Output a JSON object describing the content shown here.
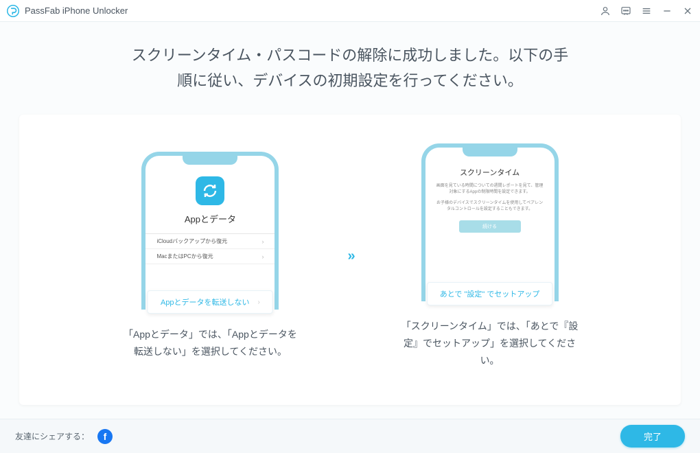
{
  "app": {
    "title": "PassFab iPhone Unlocker"
  },
  "header": {
    "line1": "スクリーンタイム・パスコードの解除に成功しました。以下の手",
    "line2": "順に従い、デバイスの初期設定を行ってください。"
  },
  "step1": {
    "phone_title": "Appとデータ",
    "row1": "iCloudバックアップから復元",
    "row2": "MacまたはPCから復元",
    "highlight": "Appとデータを転送しない",
    "desc": "「Appとデータ」では、「Appとデータを転送しない」を選択してください。"
  },
  "arrow": "»",
  "step2": {
    "phone_title": "スクリーンタイム",
    "desc1": "画面を見ている時間についての週間レポートを見て、管理対象にするAppの制限時間を設定できます。",
    "desc2": "お子様のデバイスでスクリーンタイムを使用してペアレンタルコントロールを設定することもできます。",
    "inner_button": "続ける",
    "highlight": "あとで \"設定\" でセットアップ",
    "desc": "「スクリーンタイム」では、「あとで『設定』でセットアップ」を選択してください。"
  },
  "footer": {
    "share_label": "友達にシェアする：",
    "done": "完了"
  },
  "icons": {
    "account": "account-icon",
    "feedback": "feedback-icon",
    "menu": "menu-icon",
    "minimize": "minimize-icon",
    "close": "close-icon",
    "refresh": "refresh-icon"
  }
}
